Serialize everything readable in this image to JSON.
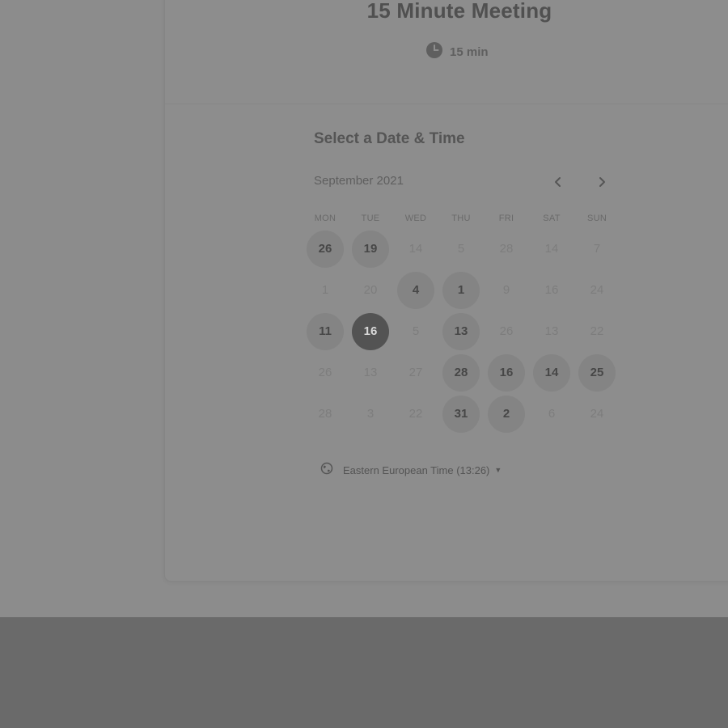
{
  "event": {
    "title": "15 Minute Meeting",
    "duration": "15 min",
    "duration_icon": "clock-icon"
  },
  "scheduler": {
    "heading": "Select a Date & Time",
    "month_label": "September 2021",
    "prev_icon": "chevron-left-icon",
    "next_icon": "chevron-right-icon",
    "weekdays": [
      "MON",
      "TUE",
      "WED",
      "THU",
      "FRI",
      "SAT",
      "SUN"
    ],
    "days": [
      {
        "label": "26",
        "state": "available"
      },
      {
        "label": "19",
        "state": "available"
      },
      {
        "label": "14",
        "state": "disabled"
      },
      {
        "label": "5",
        "state": "disabled"
      },
      {
        "label": "28",
        "state": "disabled"
      },
      {
        "label": "14",
        "state": "disabled"
      },
      {
        "label": "7",
        "state": "disabled"
      },
      {
        "label": "1",
        "state": "disabled"
      },
      {
        "label": "20",
        "state": "disabled"
      },
      {
        "label": "4",
        "state": "available"
      },
      {
        "label": "1",
        "state": "available"
      },
      {
        "label": "9",
        "state": "disabled"
      },
      {
        "label": "16",
        "state": "disabled"
      },
      {
        "label": "24",
        "state": "disabled"
      },
      {
        "label": "11",
        "state": "available"
      },
      {
        "label": "16",
        "state": "selected"
      },
      {
        "label": "5",
        "state": "disabled"
      },
      {
        "label": "13",
        "state": "available"
      },
      {
        "label": "26",
        "state": "disabled"
      },
      {
        "label": "13",
        "state": "disabled"
      },
      {
        "label": "22",
        "state": "disabled"
      },
      {
        "label": "26",
        "state": "disabled"
      },
      {
        "label": "13",
        "state": "disabled"
      },
      {
        "label": "27",
        "state": "disabled"
      },
      {
        "label": "28",
        "state": "available"
      },
      {
        "label": "16",
        "state": "available"
      },
      {
        "label": "14",
        "state": "available"
      },
      {
        "label": "25",
        "state": "available"
      },
      {
        "label": "28",
        "state": "disabled"
      },
      {
        "label": "3",
        "state": "disabled"
      },
      {
        "label": "22",
        "state": "disabled"
      },
      {
        "label": "31",
        "state": "available"
      },
      {
        "label": "2",
        "state": "available"
      },
      {
        "label": "6",
        "state": "disabled"
      },
      {
        "label": "24",
        "state": "disabled"
      }
    ],
    "timezone_label": "Eastern European Time (13:26)",
    "timezone_icon": "globe-icon"
  },
  "colors": {
    "overlay": "#8c8c8c",
    "selected_day": "#535353",
    "available_day": "#848484"
  }
}
